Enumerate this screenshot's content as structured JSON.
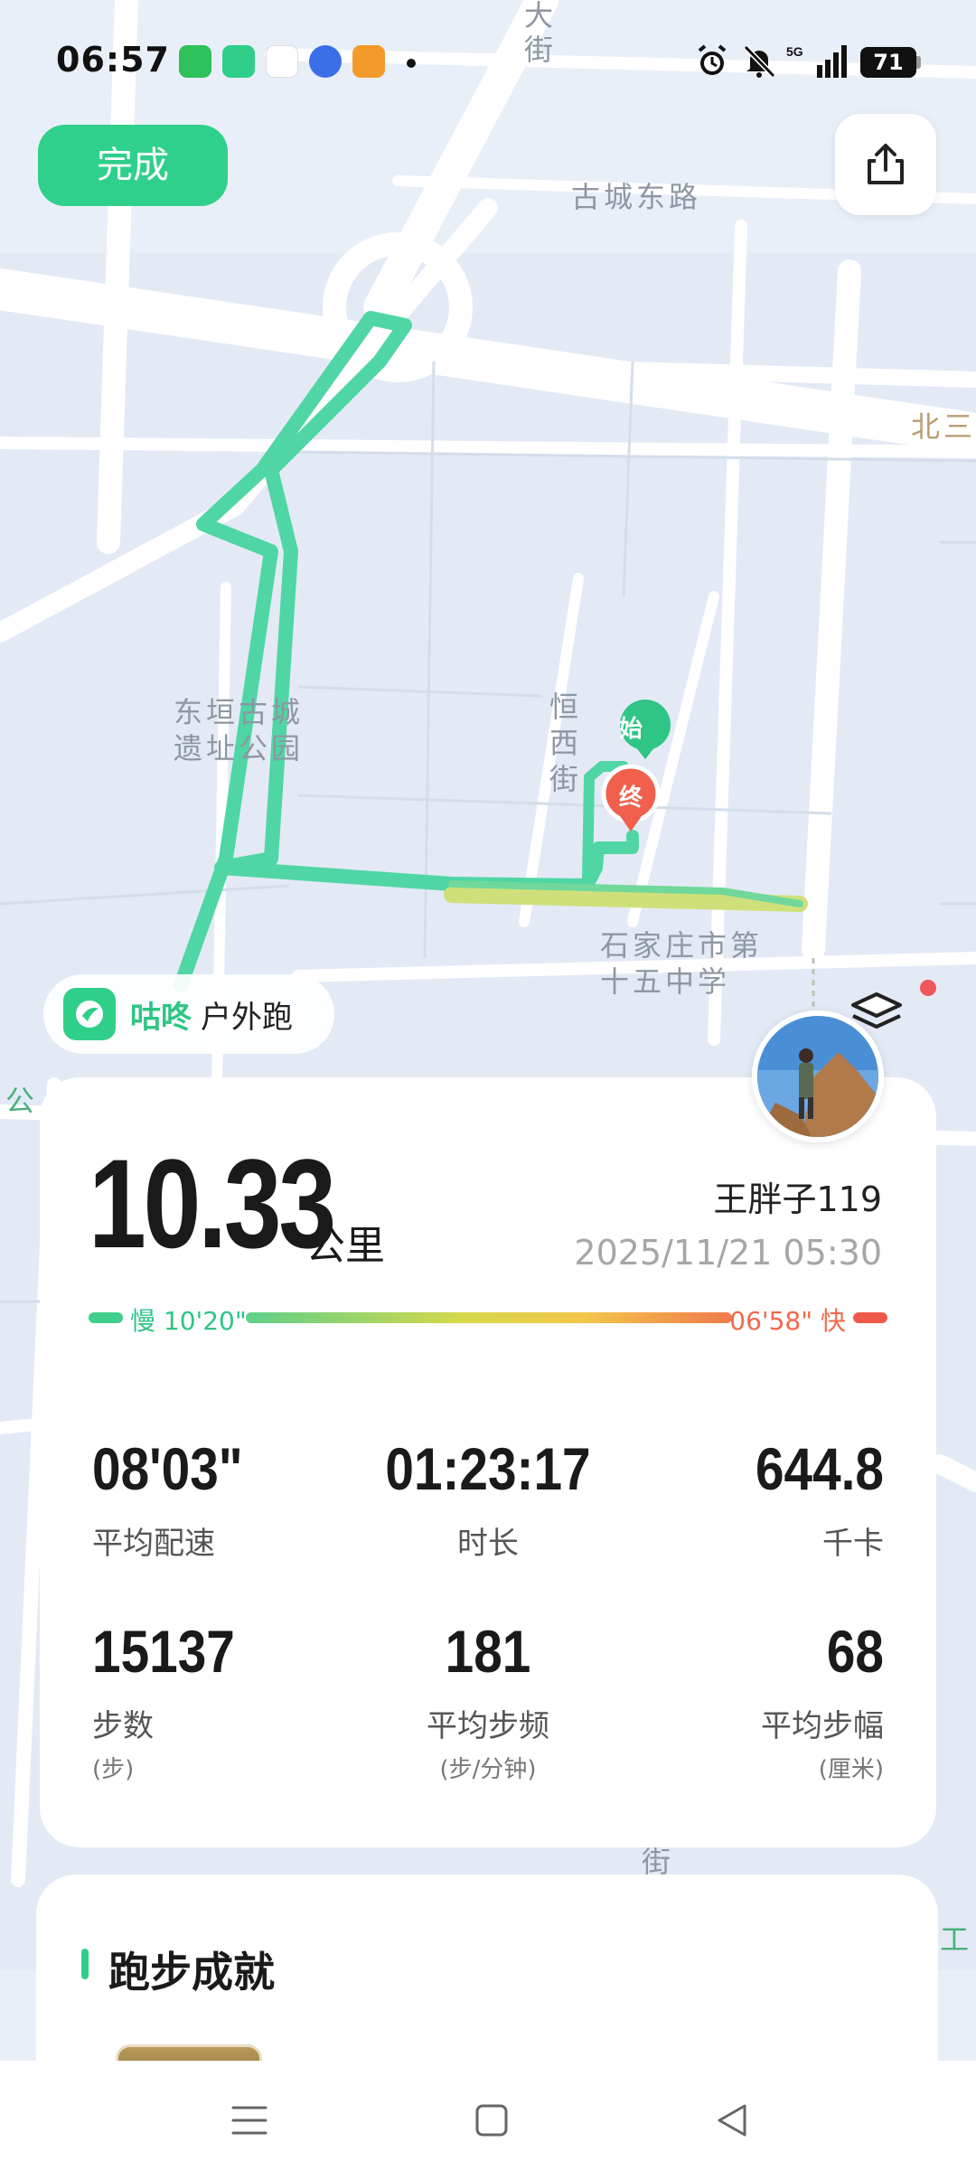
{
  "status_bar": {
    "time": "06:57",
    "app_icons": [
      "wechat-icon",
      "gudong-icon",
      "hikvision-icon",
      "baidu-icon",
      "video-app-icon"
    ],
    "network": "5G",
    "battery": "71"
  },
  "header": {
    "done_label": "完成",
    "share_icon": "share-icon"
  },
  "map": {
    "labels": {
      "street_top": "大街",
      "gucheng_east_road": "古城东路",
      "bei_san": "北三",
      "park": "东垣古城遗址公园",
      "hengxi_street": "恒西街",
      "school": "石家庄市第十五中学",
      "left_edge": "公",
      "bottom_street": "街",
      "right_edge": "工"
    },
    "start_marker": "始",
    "end_marker": "终"
  },
  "brand": {
    "name": "咕咚",
    "activity_type": "户外跑"
  },
  "summary": {
    "distance": "10.33",
    "distance_unit": "公里",
    "username": "王胖子119",
    "datetime": "2025/11/21 05:30",
    "pace_slow": "慢 10'20\"",
    "pace_fast": "06'58\" 快"
  },
  "metrics": [
    {
      "value": "08'03\"",
      "label": "平均配速",
      "sub": ""
    },
    {
      "value": "01:23:17",
      "label": "时长",
      "sub": ""
    },
    {
      "value": "644.8",
      "label": "千卡",
      "sub": ""
    },
    {
      "value": "15137",
      "label": "步数",
      "sub": "(步)"
    },
    {
      "value": "181",
      "label": "平均步频",
      "sub": "(步/分钟)"
    },
    {
      "value": "68",
      "label": "平均步幅",
      "sub": "(厘米)"
    }
  ],
  "achievements": {
    "title": "跑步成就"
  },
  "colors": {
    "accent": "#2fcf8a",
    "route": "#4fd6a4",
    "end_marker": "#f0604c",
    "pace_fast": "#f06a4a"
  }
}
